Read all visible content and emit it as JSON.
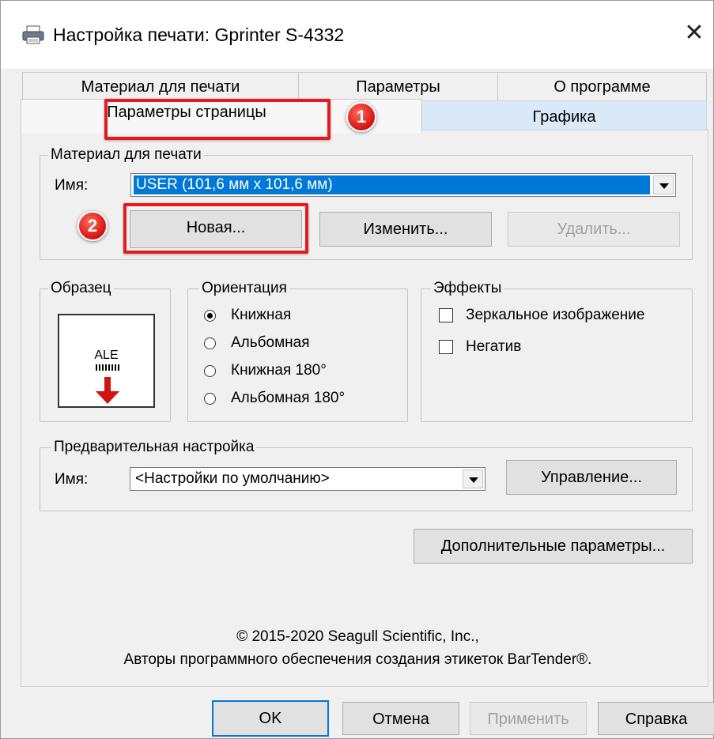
{
  "window": {
    "title": "Настройка печати: Gprinter S-4332",
    "close_glyph": "✕"
  },
  "tabs": {
    "row1": [
      "Материал для печати",
      "Параметры",
      "О программе"
    ],
    "page_params": "Параметры страницы",
    "graphics": "Графика"
  },
  "badges": {
    "one": "1",
    "two": "2"
  },
  "stock": {
    "legend": "Материал для печати",
    "name_label": "Имя:",
    "name_value": "USER (101,6 мм x 101,6 мм)",
    "new_button": "Новая...",
    "edit_button": "Изменить...",
    "delete_button": "Удалить..."
  },
  "sample": {
    "legend": "Образец",
    "preview_text": "ALE"
  },
  "orientation": {
    "legend": "Ориентация",
    "options": [
      {
        "label": "Книжная",
        "selected": true
      },
      {
        "label": "Альбомная",
        "selected": false
      },
      {
        "label": "Книжная 180°",
        "selected": false
      },
      {
        "label": "Альбомная 180°",
        "selected": false
      }
    ]
  },
  "effects": {
    "legend": "Эффекты",
    "mirror": "Зеркальное изображение",
    "negative": "Негатив"
  },
  "preset": {
    "legend": "Предварительная настройка",
    "name_label": "Имя:",
    "value": "<Настройки по умолчанию>",
    "manage_button": "Управление..."
  },
  "advanced_button": "Дополнительные параметры...",
  "copyright": {
    "line1": "© 2015-2020 Seagull Scientific, Inc.,",
    "line2": "Авторы программного обеспечения создания этикеток BarTender®."
  },
  "footer": {
    "ok": "OK",
    "cancel": "Отмена",
    "apply": "Применить",
    "help": "Справка"
  },
  "colors": {
    "highlight": "#e31b1b",
    "selection": "#0078d7",
    "graphics_tab": "#d9e9f8"
  }
}
